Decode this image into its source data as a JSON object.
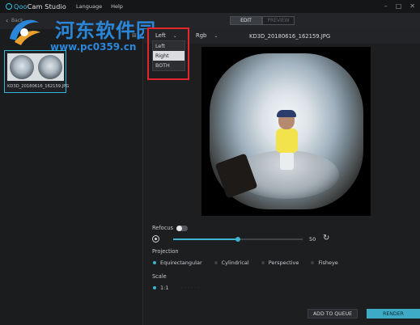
{
  "app": {
    "logo_prefix": "Qoo",
    "logo_suffix": "Cam Studio",
    "menu": [
      "Language",
      "Help"
    ]
  },
  "watermark": {
    "title": "河东软件园",
    "url": "www.pc0359.cn"
  },
  "subbar": {
    "back_label": "Back",
    "tabs": [
      {
        "label": "EDIT",
        "active": true
      },
      {
        "label": "PREVIEW",
        "active": false
      }
    ]
  },
  "library": {
    "items": [
      {
        "name": "KD3D_20180616_162159.JPG",
        "selected": true
      }
    ]
  },
  "editor": {
    "eye_select": {
      "value": "Left",
      "options": [
        "Left",
        "Right",
        "BOTH"
      ],
      "highlighted": "Right"
    },
    "color_select": {
      "value": "Rgb"
    },
    "filename": "KD3D_20180616_162159.JPG"
  },
  "controls": {
    "refocus_label": "Refocus",
    "refocus_on": false,
    "slider_value": 50,
    "slider_fraction": 0.5,
    "projection_label": "Projection",
    "projections": [
      {
        "label": "Equirectangular",
        "selected": true
      },
      {
        "label": "Cylindrical",
        "selected": false
      },
      {
        "label": "Perspective",
        "selected": false
      },
      {
        "label": "Fisheye",
        "selected": false
      }
    ],
    "scale_label": "Scale",
    "scales": [
      {
        "label": "1:1",
        "selected": true
      }
    ]
  },
  "actions": {
    "add_to_queue": "ADD TO QUEUE",
    "render": "RENDER"
  },
  "colors": {
    "accent": "#3fb3d0",
    "highlight_box": "#e3262b",
    "watermark": "#2a86d8"
  }
}
